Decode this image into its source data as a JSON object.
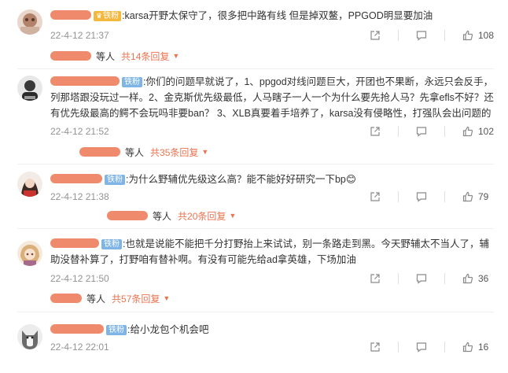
{
  "comments": [
    {
      "badge": "铁粉",
      "badge_type": "gold",
      "text": ":karsa开野太保守了，很多把中路有线 但是掉双鳌，PPGOD明显要加油",
      "time": "22-4-12 21:37",
      "likes": "108",
      "replies": {
        "suffix": "等人",
        "count": "共14条回复"
      }
    },
    {
      "badge": "铁粉",
      "badge_type": "fan",
      "text": ":你们的问题早就说了，1、ppgod对线问题巨大，开团也不果断，永远只会反手，列那塔跟没玩过一样。2、金克斯优先级最低，人马瞎子一人一个为什么要先抢人马？先拿efls不好？还有优先级最高的鳄不会玩吗非要ban？ 3、XLB真要着手培养了，karsa没有侵略性，打强队会出问题的",
      "time": "22-4-12 21:52",
      "likes": "102",
      "replies": {
        "suffix": "等人",
        "count": "共35条回复"
      }
    },
    {
      "badge": "铁粉",
      "badge_type": "fan",
      "text": ":为什么野辅优先级这么高？能不能好好研究一下bp",
      "emoji": "😊",
      "time": "22-4-12 21:38",
      "likes": "79",
      "replies": {
        "suffix": "等人",
        "count": "共20条回复"
      }
    },
    {
      "badge": "铁粉",
      "badge_type": "fan",
      "text": ":也就是说能不能把千分打野抬上来试试，别一条路走到黑。今天野辅太不当人了，辅助没替补算了，打野咱有替补啊。有没有可能先给ad拿英雄，下场加油",
      "time": "22-4-12 21:50",
      "likes": "36",
      "replies": {
        "suffix": "等人",
        "count": "共57条回复"
      }
    },
    {
      "badge": "铁粉",
      "badge_type": "fan",
      "text": ":给小龙包个机会吧",
      "time": "22-4-12 22:01",
      "likes": "16"
    }
  ],
  "icons": {
    "share": "share-icon",
    "comment": "comment-icon",
    "like": "thumbs-up-icon",
    "expand": "caret-down-icon"
  },
  "colors": {
    "reply_accent": "#eb7350",
    "fan_badge": "#7fb5e6",
    "gold_badge": "#f5b83e",
    "timestamp": "#939393"
  }
}
